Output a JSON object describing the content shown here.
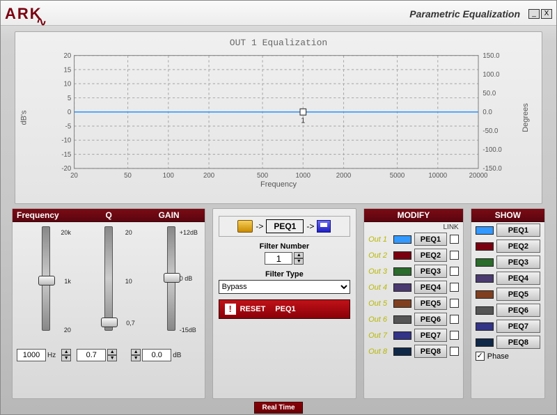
{
  "window": {
    "logo": "ARK",
    "title": "Parametric Equalization"
  },
  "chart_data": {
    "type": "line",
    "title": "OUT 1 Equalization",
    "xlabel": "Frequency",
    "ylabel_left": "dB's",
    "ylabel_right": "Degrees",
    "x_ticks": [
      20,
      50,
      100,
      200,
      500,
      1000,
      2000,
      5000,
      10000,
      20000
    ],
    "y_ticks_left": [
      -20,
      -15,
      -10,
      -5,
      0,
      5,
      10,
      15,
      20
    ],
    "y_ticks_right": [
      -150.0,
      -100.0,
      -50.0,
      0.0,
      50.0,
      100.0,
      150.0
    ],
    "xlim": [
      20,
      20000
    ],
    "ylim_left": [
      -20,
      20
    ],
    "series": [
      {
        "name": "PEQ1",
        "color": "#3399ff",
        "x": [
          20,
          20000
        ],
        "y": [
          0,
          0
        ]
      }
    ],
    "markers": [
      {
        "label": "1",
        "x": 1000,
        "y": 0
      }
    ]
  },
  "sliders": {
    "header_freq": "Frequency",
    "header_q": "Q",
    "header_gain": "GAIN",
    "freq": {
      "value": "1000",
      "unit": "Hz",
      "ticks": {
        "top": "20k",
        "mid": "1k",
        "bot": "20"
      }
    },
    "q": {
      "value": "0.7",
      "unit": "",
      "ticks": {
        "top": "20",
        "mid": "10",
        "bot": "0,7"
      }
    },
    "gain": {
      "value": "0.0",
      "unit": "dB",
      "ticks": {
        "top": "+12dB",
        "mid": "0 dB",
        "bot": "-15dB"
      }
    }
  },
  "route": {
    "peq_label": "PEQ1",
    "filter_number_label": "Filter Number",
    "filter_number": "1",
    "filter_type_label": "Filter Type",
    "filter_type": "Bypass",
    "reset_label": "RESET",
    "reset_target": "PEQ1"
  },
  "modify": {
    "title": "MODIFY",
    "link_label": "LINK",
    "rows": [
      {
        "out": "Out 1",
        "peq": "PEQ1",
        "color": "#3399ff"
      },
      {
        "out": "Out 2",
        "peq": "PEQ2",
        "color": "#7a0010"
      },
      {
        "out": "Out 3",
        "peq": "PEQ3",
        "color": "#2b6b2b"
      },
      {
        "out": "Out 4",
        "peq": "PEQ4",
        "color": "#4a3a70"
      },
      {
        "out": "Out 5",
        "peq": "PEQ5",
        "color": "#804020"
      },
      {
        "out": "Out 6",
        "peq": "PEQ6",
        "color": "#555555"
      },
      {
        "out": "Out 7",
        "peq": "PEQ7",
        "color": "#333388"
      },
      {
        "out": "Out 8",
        "peq": "PEQ8",
        "color": "#102848"
      }
    ]
  },
  "show": {
    "title": "SHOW",
    "rows": [
      {
        "peq": "PEQ1",
        "color": "#3399ff"
      },
      {
        "peq": "PEQ2",
        "color": "#7a0010"
      },
      {
        "peq": "PEQ3",
        "color": "#2b6b2b"
      },
      {
        "peq": "PEQ4",
        "color": "#4a3a70"
      },
      {
        "peq": "PEQ5",
        "color": "#804020"
      },
      {
        "peq": "PEQ6",
        "color": "#555555"
      },
      {
        "peq": "PEQ7",
        "color": "#333388"
      },
      {
        "peq": "PEQ8",
        "color": "#102848"
      }
    ],
    "phase_label": "Phase",
    "phase_checked": true
  },
  "footer": {
    "realtime": "Real Time"
  }
}
